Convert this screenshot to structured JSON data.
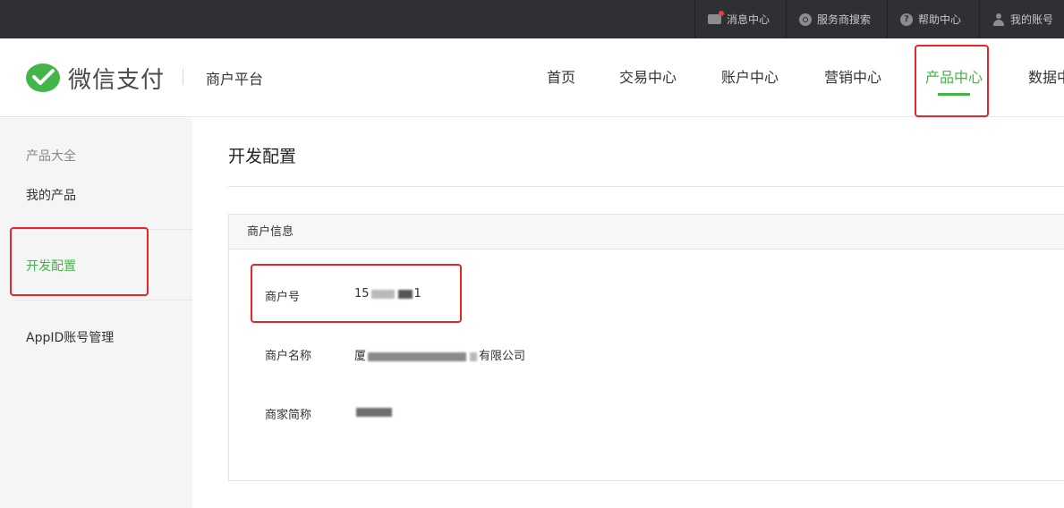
{
  "topbar": {
    "items": [
      {
        "label": "消息中心",
        "icon": "mail-icon"
      },
      {
        "label": "服务商搜索",
        "icon": "search-icon"
      },
      {
        "label": "帮助中心",
        "icon": "help-icon"
      },
      {
        "label": "我的账号",
        "icon": "user-icon"
      }
    ]
  },
  "header": {
    "brand": "微信支付",
    "platform": "商户平台",
    "nav": [
      "首页",
      "交易中心",
      "账户中心",
      "营销中心",
      "产品中心",
      "数据中"
    ],
    "active_nav": "产品中心"
  },
  "sidebar": {
    "group_title": "产品大全",
    "items": [
      "我的产品",
      "开发配置",
      "AppID账号管理"
    ],
    "active_item": "开发配置"
  },
  "main": {
    "title": "开发配置",
    "panel_title": "商户信息",
    "fields": [
      {
        "label": "商户号",
        "value_prefix": "15",
        "value_suffix": "1"
      },
      {
        "label": "商户名称",
        "value_prefix": "厦",
        "value_suffix": "有限公司"
      },
      {
        "label": "商家简称",
        "value_prefix": "",
        "value_suffix": ""
      }
    ]
  },
  "colors": {
    "accent": "#44b549",
    "highlight_box": "#e5272a",
    "topbar_bg": "#2f3033"
  }
}
